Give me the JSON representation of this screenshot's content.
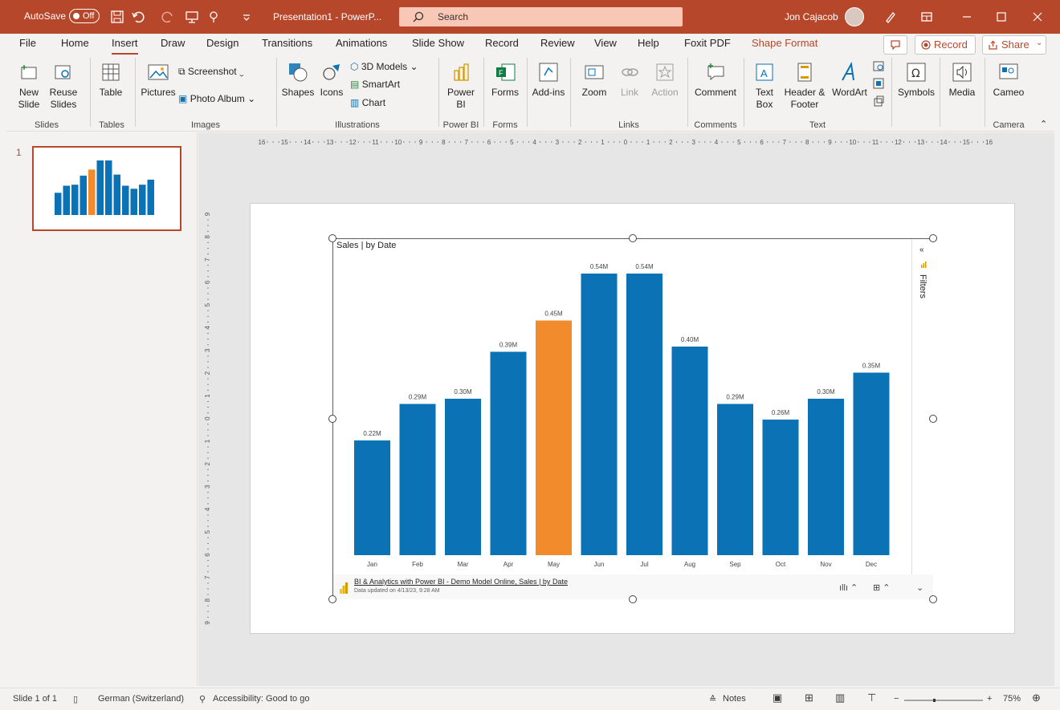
{
  "titlebar": {
    "autosave_label": "AutoSave",
    "autosave_state": "Off",
    "document_title": "Presentation1 - PowerP...",
    "search_placeholder": "Search",
    "user_name": "Jon Cajacob"
  },
  "tabs": [
    "File",
    "Home",
    "Insert",
    "Draw",
    "Design",
    "Transitions",
    "Animations",
    "Slide Show",
    "Record",
    "Review",
    "View",
    "Help",
    "Foxit PDF",
    "Shape Format"
  ],
  "active_tab": "Insert",
  "record_button": "Record",
  "share_button": "Share",
  "ribbon": {
    "slides": {
      "new_slide": "New Slide",
      "reuse_slides": "Reuse Slides",
      "label": "Slides"
    },
    "tables": {
      "table": "Table",
      "label": "Tables"
    },
    "images": {
      "pictures": "Pictures",
      "screenshot": "Screenshot",
      "photo_album": "Photo Album",
      "label": "Images"
    },
    "illustrations": {
      "shapes": "Shapes",
      "icons": "Icons",
      "models": "3D Models",
      "smartart": "SmartArt",
      "chart": "Chart",
      "label": "Illustrations"
    },
    "powerbi": {
      "btn": "Power BI",
      "label": "Power BI"
    },
    "forms": {
      "btn": "Forms",
      "label": "Forms"
    },
    "addins": {
      "btn": "Add-ins"
    },
    "links": {
      "zoom": "Zoom",
      "link": "Link",
      "action": "Action",
      "label": "Links"
    },
    "comments": {
      "comment": "Comment",
      "label": "Comments"
    },
    "text": {
      "textbox": "Text Box",
      "header_footer": "Header & Footer",
      "wordart": "WordArt",
      "label": "Text"
    },
    "symbols": {
      "btn": "Symbols"
    },
    "media": {
      "btn": "Media"
    },
    "camera": {
      "cameo": "Cameo",
      "label": "Camera"
    }
  },
  "slide_panel": {
    "slide_number": "1"
  },
  "chart_data": {
    "type": "bar",
    "title": "Sales | by Date",
    "categories": [
      "Jan",
      "Feb",
      "Mar",
      "Apr",
      "May",
      "Jun",
      "Jul",
      "Aug",
      "Sep",
      "Oct",
      "Nov",
      "Dec"
    ],
    "values": [
      0.22,
      0.29,
      0.3,
      0.39,
      0.45,
      0.54,
      0.54,
      0.4,
      0.29,
      0.26,
      0.3,
      0.35
    ],
    "labels": [
      "0.22M",
      "0.29M",
      "0.30M",
      "0.39M",
      "0.45M",
      "0.54M",
      "0.54M",
      "0.40M",
      "0.29M",
      "0.26M",
      "0.30M",
      "0.35M"
    ],
    "highlight_index": 4,
    "bar_color": "#0a72b5",
    "highlight_color": "#f28b2b",
    "ylim": [
      0,
      0.54
    ],
    "grid": false
  },
  "visual_footer": {
    "source": "BI & Analytics with Power BI - Demo Model Online, Sales | by Date",
    "updated": "Data updated on 4/13/23, 9:28 AM"
  },
  "filters_label": "Filters",
  "statusbar": {
    "slide_info": "Slide 1 of 1",
    "language": "German (Switzerland)",
    "accessibility": "Accessibility: Good to go",
    "notes": "Notes",
    "zoom": "75%"
  },
  "colors": {
    "accent": "#b7472a",
    "search_bg": "#f9c7b6"
  }
}
